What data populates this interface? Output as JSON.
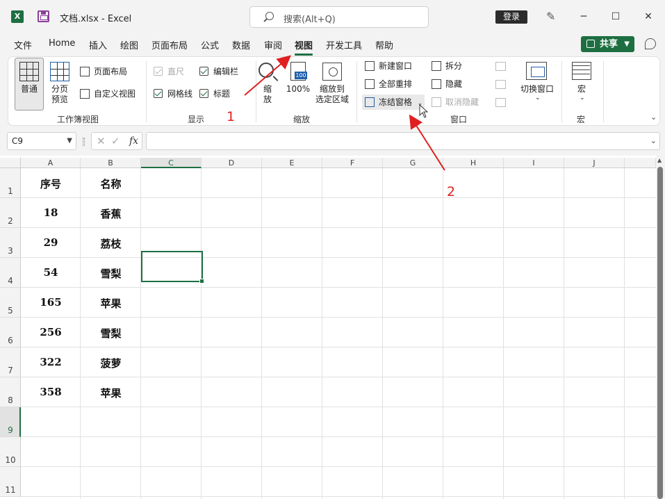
{
  "title_bar": {
    "app_logo": "X",
    "document_title": "文档.xlsx  -  Excel",
    "search_placeholder": "搜索(Alt+Q)",
    "login_label": "登录",
    "minimize": "─",
    "maximize": "☐",
    "close": "✕"
  },
  "tabs": [
    {
      "label": "文件"
    },
    {
      "label": "Home"
    },
    {
      "label": "插入"
    },
    {
      "label": "绘图"
    },
    {
      "label": "页面布局"
    },
    {
      "label": "公式"
    },
    {
      "label": "数据"
    },
    {
      "label": "审阅"
    },
    {
      "label": "视图",
      "active": true
    },
    {
      "label": "开发工具"
    },
    {
      "label": "帮助"
    }
  ],
  "share_label": "共享",
  "ribbon": {
    "workbook_views": {
      "label": "工作簿视图",
      "normal": "普通",
      "page_break": "分页\n预览",
      "page_layout": "页面布局",
      "custom_views": "自定义视图"
    },
    "show": {
      "label": "显示",
      "ruler": "直尺",
      "formula_bar": "编辑栏",
      "gridlines": "网格线",
      "headings": "标题"
    },
    "zoom": {
      "label": "缩放",
      "zoom": "缩\n放",
      "zoom_100": "100%",
      "zoom_badge": "100",
      "zoom_selection": "缩放到\n选定区域"
    },
    "window": {
      "label": "窗口",
      "new_window": "新建窗口",
      "arrange_all": "全部重排",
      "freeze_panes": "冻结窗格",
      "split": "拆分",
      "hide": "隐藏",
      "unhide": "取消隐藏",
      "switch_windows": "切换窗口"
    },
    "macros": {
      "label": "宏",
      "macros": "宏"
    }
  },
  "formula_bar": {
    "name_box": "C9",
    "fx": "fx",
    "formula": ""
  },
  "sheet": {
    "columns": [
      "A",
      "B",
      "C",
      "D",
      "E",
      "F",
      "G",
      "H",
      "I",
      "J"
    ],
    "rows": [
      "1",
      "2",
      "3",
      "4",
      "5",
      "6",
      "7",
      "8",
      "9",
      "10",
      "11"
    ],
    "active_cell": "C9",
    "cells": [
      [
        "序号",
        "名称"
      ],
      [
        "18",
        "香蕉"
      ],
      [
        "29",
        "荔枝"
      ],
      [
        "54",
        "雪梨"
      ],
      [
        "165",
        "苹果"
      ],
      [
        "256",
        "雪梨"
      ],
      [
        "322",
        "菠萝"
      ],
      [
        "358",
        "苹果"
      ]
    ]
  },
  "annotations": {
    "step1": "1",
    "step2": "2",
    "color": "#e02020"
  },
  "colors": {
    "accent": "#1d6f42"
  }
}
